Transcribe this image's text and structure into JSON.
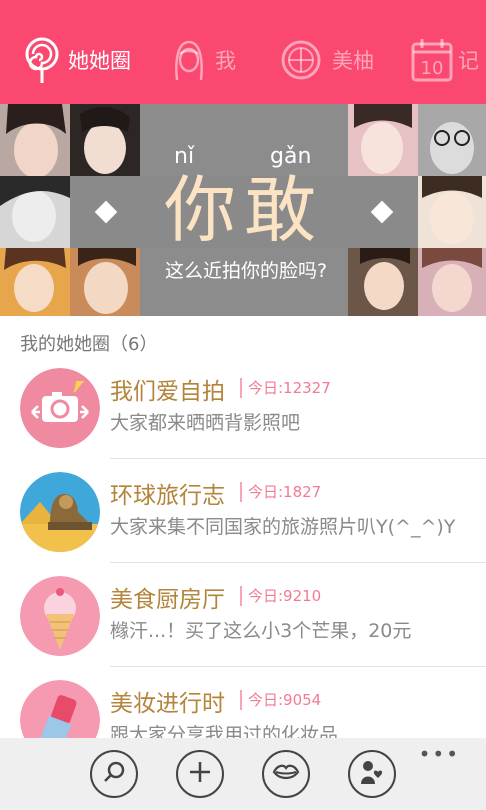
{
  "tabs": [
    {
      "label": "她她圈",
      "icon": "lollipop-icon",
      "active": true
    },
    {
      "label": "我",
      "icon": "girl-avatar-icon",
      "active": false
    },
    {
      "label": "美柚",
      "icon": "grapefruit-icon",
      "active": false
    },
    {
      "label": "记",
      "icon": "calendar-icon",
      "calendar_day": "10",
      "active": false
    }
  ],
  "banner": {
    "pinyin_1": "nǐ",
    "pinyin_2": "gǎn",
    "headline": "你敢",
    "subline": "这么近拍你的脸吗?"
  },
  "section": {
    "title": "我的她她圈（6）"
  },
  "circles": [
    {
      "name": "我们爱自拍",
      "today": "今日:12327",
      "desc": "大家都来晒晒背影照吧",
      "icon": "camera-icon"
    },
    {
      "name": "环球旅行志",
      "today": "今日:1827",
      "desc": "大家来集不同国家的旅游照片叭Y(^_^)Y",
      "icon": "sphinx-icon"
    },
    {
      "name": "美食厨房厅",
      "today": "今日:9210",
      "desc": "橼汗...！买了这么小3个芒果，20元",
      "icon": "ice-cream-icon"
    },
    {
      "name": "美妆进行时",
      "today": "今日:9054",
      "desc": "跟大家分享我用过的化妆品",
      "icon": "lipstick-icon"
    }
  ],
  "appbar": {
    "buttons": [
      "search-icon",
      "add-icon",
      "lips-icon",
      "mother-baby-icon"
    ],
    "more": "•••"
  },
  "colors": {
    "accent": "#fa4870",
    "title": "#b3843a",
    "today": "#f27a93"
  }
}
